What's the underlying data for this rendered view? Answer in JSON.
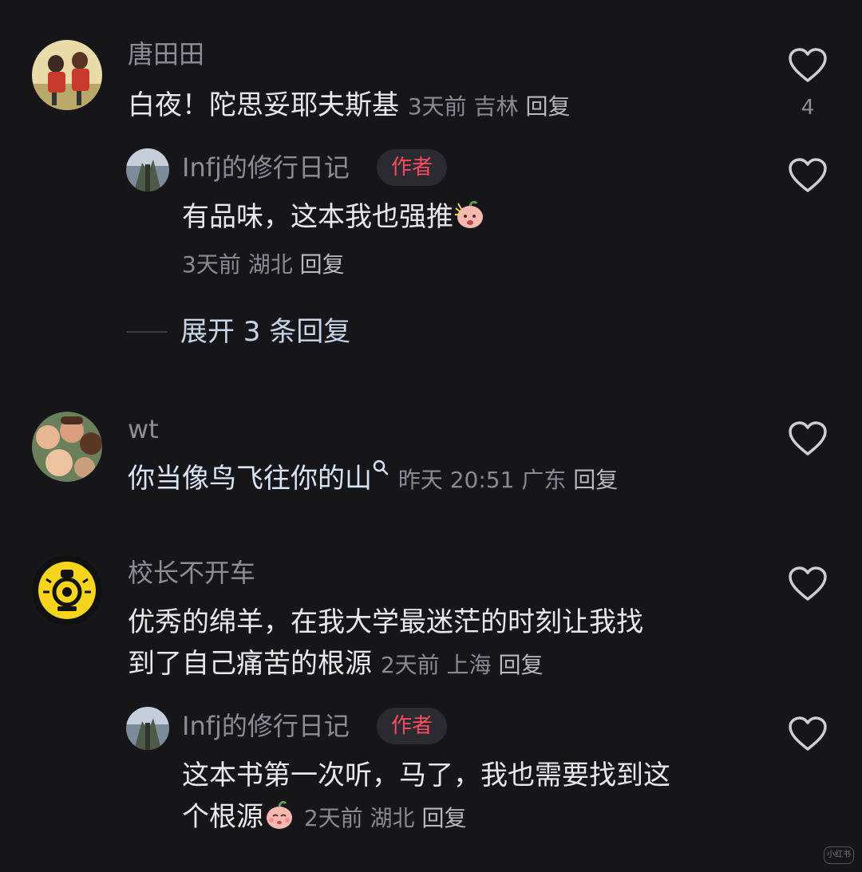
{
  "comments": [
    {
      "username": "唐田田",
      "text": "白夜！陀思妥耶夫斯基",
      "meta": {
        "time": "3天前",
        "location": "吉林",
        "reply": "回复"
      },
      "likes": "4",
      "replies": [
        {
          "username": "Infj的修行日记",
          "badge": "作者",
          "text": "有品味，这本我也强推",
          "meta": {
            "time": "3天前",
            "location": "湖北",
            "reply": "回复"
          }
        }
      ],
      "expand_label": "展开 3 条回复"
    },
    {
      "username": "wt",
      "text": "你当像鸟飞往你的山",
      "meta": {
        "time": "昨天 20:51",
        "location": "广东",
        "reply": "回复"
      }
    },
    {
      "username": "校长不开车",
      "text_line1": "优秀的绵羊，在我大学最迷茫的时刻让我找",
      "text_line2": "到了自己痛苦的根源",
      "meta": {
        "time": "2天前",
        "location": "上海",
        "reply": "回复"
      },
      "replies": [
        {
          "username": "Infj的修行日记",
          "badge": "作者",
          "text_line1": "这本书第一次听，马了，我也需要找到这",
          "text_line2": "个根源",
          "meta": {
            "time": "2天前",
            "location": "湖北",
            "reply": "回复"
          }
        }
      ]
    }
  ],
  "icons": [
    "heart-icon",
    "search-hint-icon",
    "blush-emoji-icon",
    "peach-emoji-icon"
  ],
  "colors": {
    "background": "#16161a",
    "badge_text": "#ff4d5e",
    "expand_text": "#c9d4e6"
  },
  "watermark": "小红书"
}
